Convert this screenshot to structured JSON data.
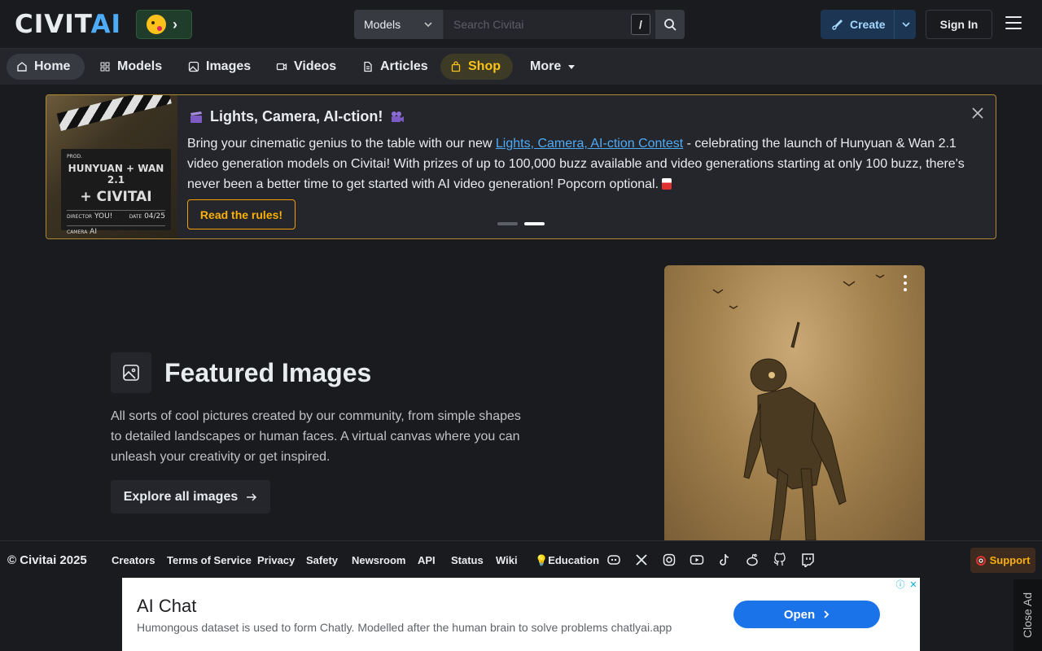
{
  "header": {
    "logo_main": "CIVIT",
    "logo_accent": "AI",
    "search": {
      "category": "Models",
      "placeholder": "Search Civitai",
      "shortcut": "/"
    },
    "create_label": "Create",
    "signin_label": "Sign In"
  },
  "nav": {
    "items": [
      {
        "label": "Home",
        "icon": "home-icon"
      },
      {
        "label": "Models",
        "icon": "grid-icon"
      },
      {
        "label": "Images",
        "icon": "image-icon"
      },
      {
        "label": "Videos",
        "icon": "video-icon"
      },
      {
        "label": "Articles",
        "icon": "file-icon"
      },
      {
        "label": "Shop",
        "icon": "shopping-bag-icon"
      },
      {
        "label": "More",
        "icon": "caret-down-icon"
      }
    ]
  },
  "banner": {
    "title": "Lights, Camera, AI-ction!",
    "text_before": "Bring your cinematic genius to the table with our new ",
    "link_text": "Lights, Camera, AI-ction Contest",
    "text_after": " - celebrating the launch of Hunyuan & Wan 2.1 video generation models on Civitai! With prizes of up to 100,000 buzz available and video generations starting at only 100 buzz, there's never been a better time to get started with AI video generation! Popcorn optional.",
    "button_label": "Read the rules!",
    "clapper": {
      "prod": "PROD.",
      "line1": "HUNYUAN + WAN 2.1",
      "line2": "+ CIVITAI",
      "director_label": "DIRECTOR",
      "director": "YOU!",
      "camera_label": "CAMERA",
      "camera": "AI",
      "date_label": "DATE",
      "date": "04/25"
    },
    "slide_count": 2,
    "active_slide": 2
  },
  "featured": {
    "title": "Featured Images",
    "description": "All sorts of cool pictures created by our community, from simple shapes to detailed landscapes or human faces. A virtual canvas where you can unleash your creativity or get inspired.",
    "button_label": "Explore all images"
  },
  "footer": {
    "copyright": "© Civitai 2025",
    "links": [
      "Creators",
      "Terms of Service",
      "Privacy",
      "Safety",
      "Newsroom",
      "API",
      "Status",
      "Wiki",
      "Education"
    ],
    "social_icons": [
      "discord-icon",
      "x-icon",
      "instagram-icon",
      "youtube-icon",
      "tiktok-icon",
      "reddit-icon",
      "github-icon",
      "twitch-icon"
    ],
    "support_label": "Support"
  },
  "ad": {
    "title": "AI Chat",
    "text": "Humongous dataset is used to form Chatly. Modelled after the human brain to solve problems chatlyai.app",
    "button_label": "Open",
    "close_label": "Close Ad"
  },
  "colors": {
    "accent_blue": "#4dabf7",
    "shop_yellow": "#fcc419",
    "banner_border": "#b08a32",
    "background": "#1a1b1e"
  }
}
